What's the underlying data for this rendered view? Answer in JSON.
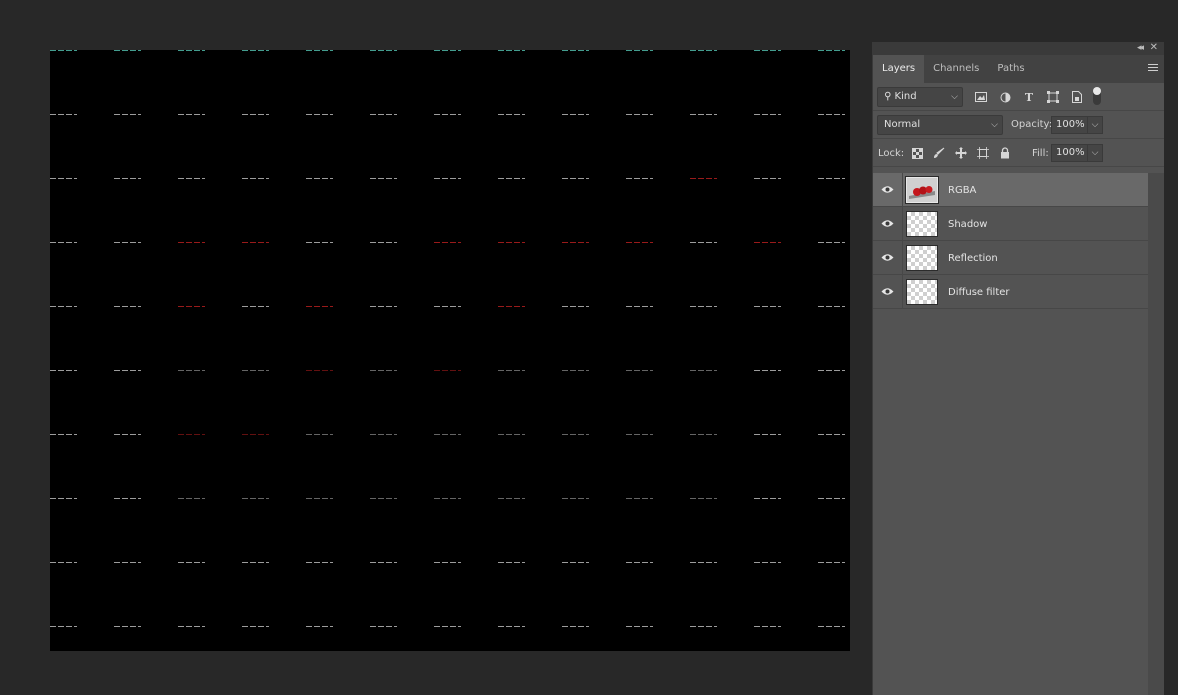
{
  "canvas": {
    "background": "#000000",
    "mark_colors": {
      "white": "#b8b8b8",
      "red": "#b41e1e",
      "teal": "#4fb9a8"
    }
  },
  "panel": {
    "tabs": [
      {
        "label": "Layers",
        "active": true
      },
      {
        "label": "Channels",
        "active": false
      },
      {
        "label": "Paths",
        "active": false
      }
    ],
    "filter": {
      "kind_label": "Kind",
      "icons": [
        "image-filter-icon",
        "adjustment-filter-icon",
        "type-filter-icon",
        "shape-filter-icon",
        "smart-object-filter-icon"
      ]
    },
    "blend_mode": "Normal",
    "opacity_label": "Opacity:",
    "opacity_value": "100%",
    "lock_label": "Lock:",
    "lock_icons": [
      "lock-transparent-pixels-icon",
      "lock-image-pixels-icon",
      "lock-position-icon",
      "lock-artboard-icon",
      "lock-all-icon"
    ],
    "fill_label": "Fill:",
    "fill_value": "100%",
    "layers": [
      {
        "name": "RGBA",
        "selected": true,
        "visible": true
      },
      {
        "name": "Shadow",
        "selected": false,
        "visible": true
      },
      {
        "name": "Reflection",
        "selected": false,
        "visible": true
      },
      {
        "name": "Diffuse filter",
        "selected": false,
        "visible": true
      }
    ]
  }
}
